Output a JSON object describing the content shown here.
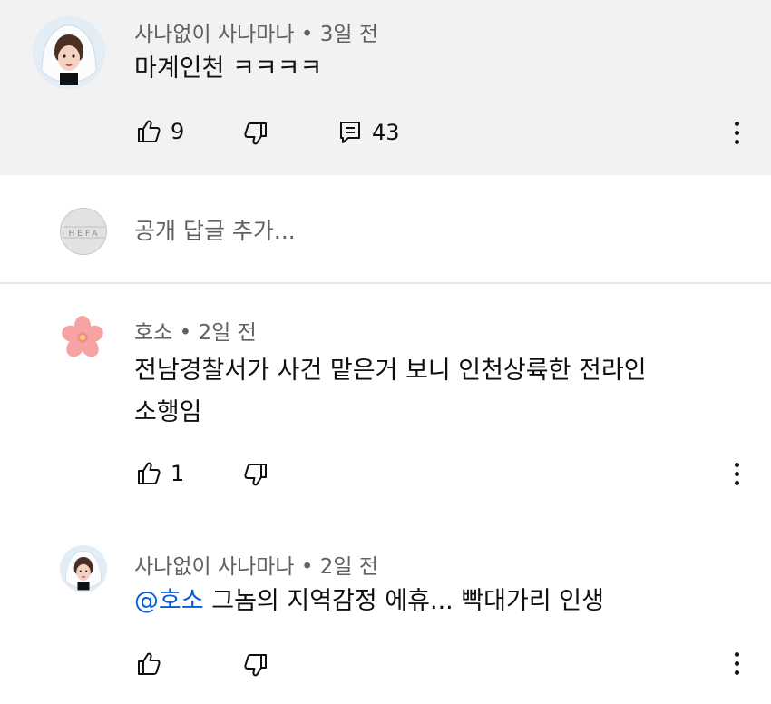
{
  "top_comment": {
    "author": "사나없이 사나마나",
    "separator": " • ",
    "time": "3일 전",
    "text": "마계인천 ㅋㅋㅋㅋ",
    "likes": "9",
    "replies": "43",
    "icons": [
      "avatar",
      "thumbs-up-icon",
      "thumbs-down-icon",
      "comment-icon",
      "more-vert-icon"
    ]
  },
  "add_reply": {
    "avatar_text": "HEFA",
    "placeholder": "공개 답글 추가..."
  },
  "replies": [
    {
      "author": "호소",
      "separator": " • ",
      "time": "2일 전",
      "text_line1": "전남경찰서가 사건 맡은거 보니 인천상륙한 전라인",
      "text_line2": "소행임",
      "likes": "1"
    },
    {
      "author": "사나없이 사나마나",
      "separator": " • ",
      "time": "2일 전",
      "mention": "@호소",
      "text": " 그놈의 지역감정 에휴... 빡대가리 인생"
    }
  ],
  "colors": {
    "top_background": "#f2f2f2",
    "meta_text": "#606060",
    "mention": "#065fd4",
    "divider": "#e5e5e5"
  }
}
